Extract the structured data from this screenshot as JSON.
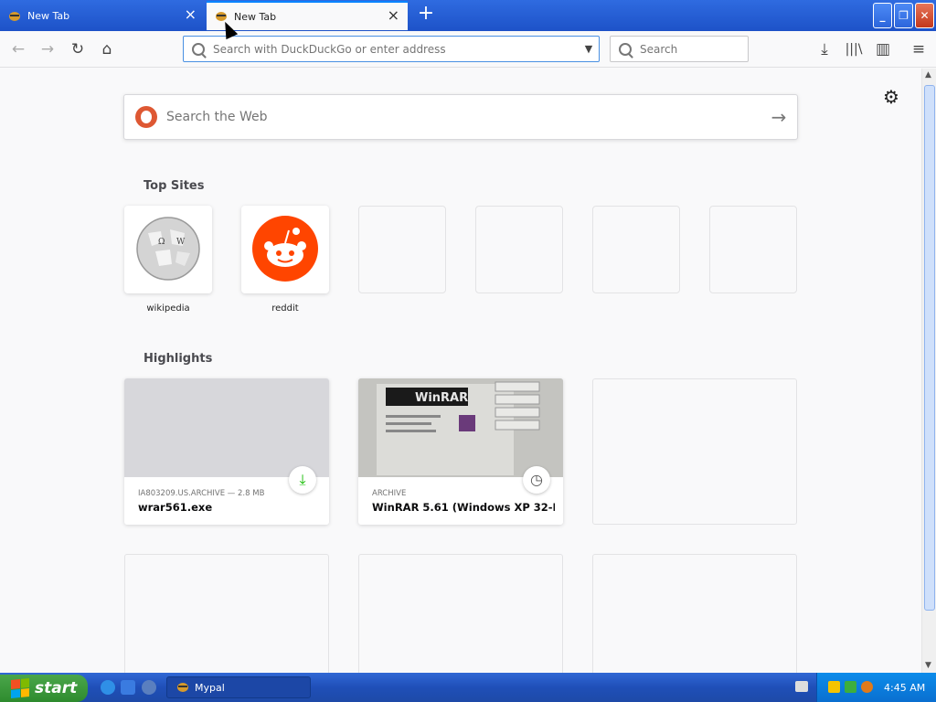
{
  "tabs": [
    {
      "label": "New Tab"
    },
    {
      "label": "New Tab"
    }
  ],
  "nav": {
    "url_placeholder": "Search with DuckDuckGo or enter address",
    "search_placeholder": "Search"
  },
  "newtab": {
    "search_placeholder": "Search the Web",
    "top_sites_heading": "Top Sites",
    "top_sites": [
      {
        "label": "wikipedia"
      },
      {
        "label": "reddit"
      }
    ],
    "highlights_heading": "Highlights",
    "highlights": [
      {
        "meta": "IA803209.US.ARCHIVE — 2.8 MB",
        "title": "wrar561.exe",
        "badge": "download-icon"
      },
      {
        "meta": "ARCHIVE",
        "title": "WinRAR 5.61 (Windows XP 32-B...",
        "badge": "clock-icon"
      }
    ]
  },
  "taskbar": {
    "start_label": "start",
    "window_label": "Mypal",
    "clock": "4:45 AM"
  },
  "colors": {
    "accent": "#0a84ff",
    "reddit": "#ff4500",
    "ddg": "#de5833",
    "download": "#12bc00"
  }
}
